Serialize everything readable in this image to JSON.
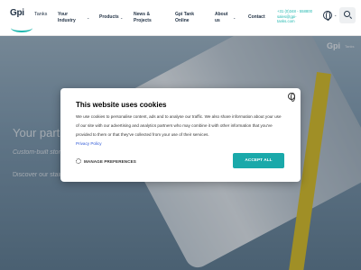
{
  "brand": {
    "logo_text": "Gpi",
    "sub": "Tanks"
  },
  "nav": [
    {
      "line1": "Your",
      "line2": "Industry",
      "has_chevron": true
    },
    {
      "line1": "Products",
      "line2": "",
      "has_chevron": true
    },
    {
      "line1": "News &",
      "line2": "Projects",
      "has_chevron": false
    },
    {
      "line1": "Gpi Tank",
      "line2": "Online",
      "has_chevron": false
    },
    {
      "line1": "About",
      "line2": "us",
      "has_chevron": true
    },
    {
      "line1": "Contact",
      "line2": "",
      "has_chevron": false
    }
  ],
  "contact": {
    "phone": "+31 (0)348 - 558800",
    "email_line1": "sales@gpi-",
    "email_line2": "tanks.com"
  },
  "icons": {
    "language": "globe-icon",
    "search": "search-icon"
  },
  "hero": {
    "title": "Your partn",
    "subtitle": "Custom-built storag",
    "subtitle2": "Discover our stainle",
    "side_logo": "Gpi",
    "side_sub": "Tanks"
  },
  "cookie": {
    "title": "This website uses cookies",
    "body": "We use cookies to personalise content, ads and to analyse our traffic. We also share information about your use of our site with our advertising and analytics partners who may combine it with other information that you've provided to them or that they've collected from your use of their services.",
    "privacy_link": "Privacy Policy",
    "manage_label": "MANAGE PREFERENCES",
    "accept_label": "ACCEPT ALL"
  },
  "colors": {
    "accent": "#1aa9aa",
    "navy": "#243447",
    "link": "#2e58d6"
  }
}
